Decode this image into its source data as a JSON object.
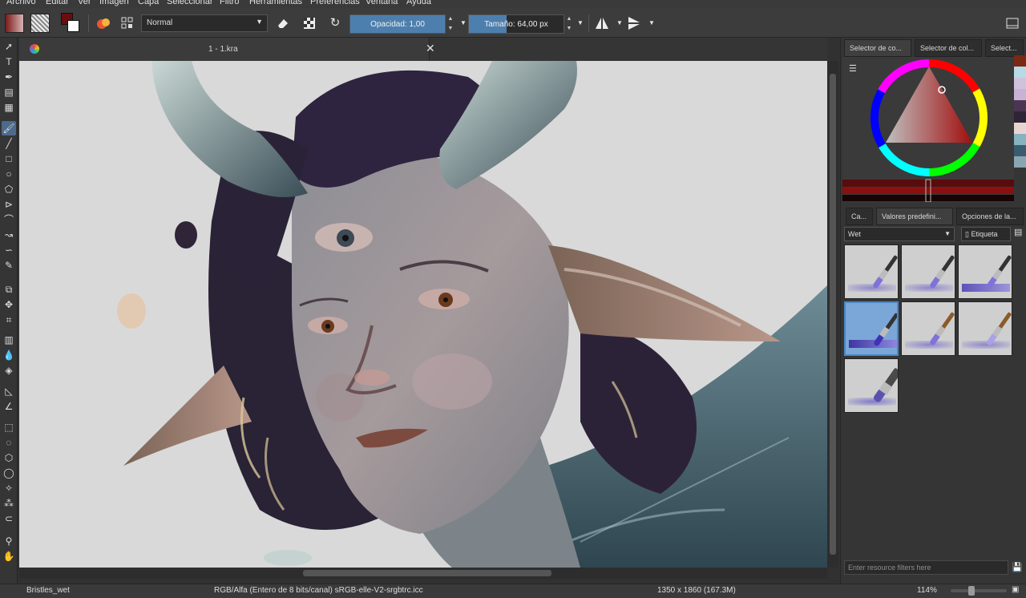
{
  "menu": [
    "Archivo",
    "Editar",
    "Ver",
    "Imagen",
    "Capa",
    "Seleccionar",
    "Filtro",
    "Herramientas",
    "Preferencias",
    "Ventana",
    "Ayuda"
  ],
  "toolbar": {
    "blend_mode": "Normal",
    "opacity_label": "Opacidad:  1,00",
    "opacity_value": 1.0,
    "size_label": "Tamaño:  64,00 px",
    "size_fraction": 0.4
  },
  "document": {
    "tab_title": "1 - 1.kra"
  },
  "dock": {
    "color_tabs": [
      "Selector de co...",
      "Selector de col...",
      "Select..."
    ],
    "preset_tabs": [
      "Ca...",
      "Valores predefini...",
      "Opciones de la..."
    ],
    "preset_filter": "Wet",
    "tag_label": "Etiqueta",
    "resource_filter_placeholder": "Enter resource filters here",
    "palette_colors": [
      "#7a2a14",
      "#b9d9e6",
      "#d0c2dc",
      "#c9b2d6",
      "#4a3552",
      "#2e2436",
      "#e8d5d0",
      "#86b3c0",
      "#3a5c6e",
      "#8aa6b1"
    ]
  },
  "status": {
    "brush_name": "Bristles_wet",
    "color_space": "RGB/Alfa (Entero de 8 bits/canal)  sRGB-elle-V2-srgbtrc.icc",
    "dimensions": "1350 x 1860 (167.3M)",
    "zoom": "114%"
  }
}
